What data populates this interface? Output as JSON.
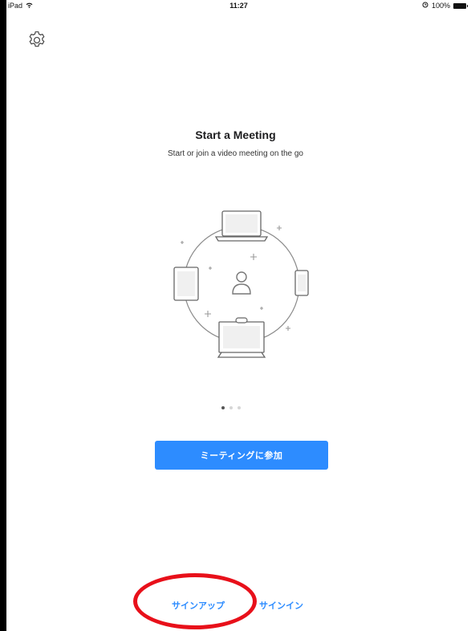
{
  "status_bar": {
    "device": "iPad",
    "time": "11:27",
    "battery": "100%"
  },
  "main": {
    "title": "Start a Meeting",
    "subtitle": "Start or join a video meeting on the go",
    "join_button_label": "ミーティングに参加"
  },
  "pager": {
    "current": 1,
    "total": 3
  },
  "footer": {
    "signup_label": "サインアップ",
    "signin_label": "サインイン"
  },
  "colors": {
    "accent": "#2d8cff",
    "annotation": "#e8101a"
  },
  "icons": [
    "wifi-icon",
    "alarm-icon",
    "battery-icon",
    "gear-icon",
    "laptop-icon",
    "tablet-icon",
    "phone-icon",
    "room-system-icon",
    "person-icon"
  ]
}
